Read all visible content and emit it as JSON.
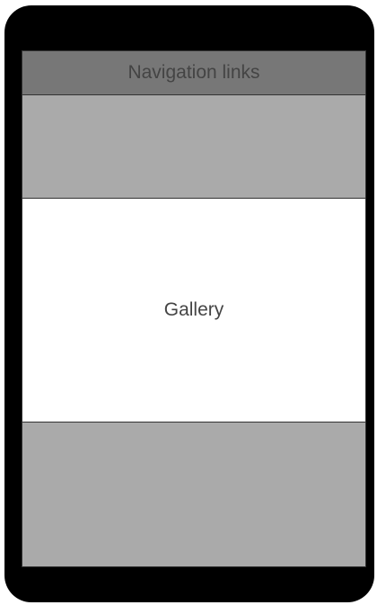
{
  "header": {
    "nav_label": "Navigation links"
  },
  "main": {
    "gallery_label": "Gallery"
  },
  "colors": {
    "device_frame": "#000000",
    "nav_background": "#777777",
    "placeholder_block": "#aaaaaa",
    "gallery_background": "#ffffff",
    "text": "#444444"
  }
}
